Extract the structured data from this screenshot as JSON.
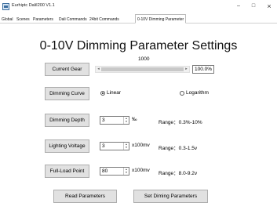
{
  "window": {
    "title": "Eurhiptc DaliI200 V1.1",
    "minimize": "–",
    "maximize": "□",
    "close": "×"
  },
  "tabs": [
    {
      "label": "Global"
    },
    {
      "label": "Scenes"
    },
    {
      "label": "Parameters"
    },
    {
      "label": "Dali Commands"
    },
    {
      "label": "24bit Commands"
    },
    {
      "label": "0-10V Dimming Parameter",
      "active": true
    }
  ],
  "heading": "0-10V Dimming Parameter Settings",
  "current_gear": {
    "button_label": "Current Gear",
    "slider_value": "1000",
    "level": 1.0,
    "percent": "100.0%",
    "left_arrow": "◂",
    "right_arrow": "▸"
  },
  "dimming_curve": {
    "button_label": "Dimming Curve",
    "options": [
      {
        "label": "Linear",
        "checked": true
      },
      {
        "label": "Logarithm",
        "checked": false
      }
    ]
  },
  "dimming_depth": {
    "button_label": "Dimming Depth",
    "value": "3",
    "unit": "‰",
    "range": "Range：0.3%-10%"
  },
  "lighting_voltage": {
    "button_label": "Lighting Voltage",
    "value": "3",
    "unit": "x100mv",
    "range": "Range：0.3-1.5v"
  },
  "full_load_point": {
    "button_label": "Full-Load Point",
    "value": "80",
    "unit": "x100mv",
    "range": "Range：8.0-9.2v"
  },
  "spin_up": "▲",
  "spin_down": "▼",
  "actions": {
    "read_label": "Read Parameters",
    "set_label": "Set Diming Parameters"
  }
}
